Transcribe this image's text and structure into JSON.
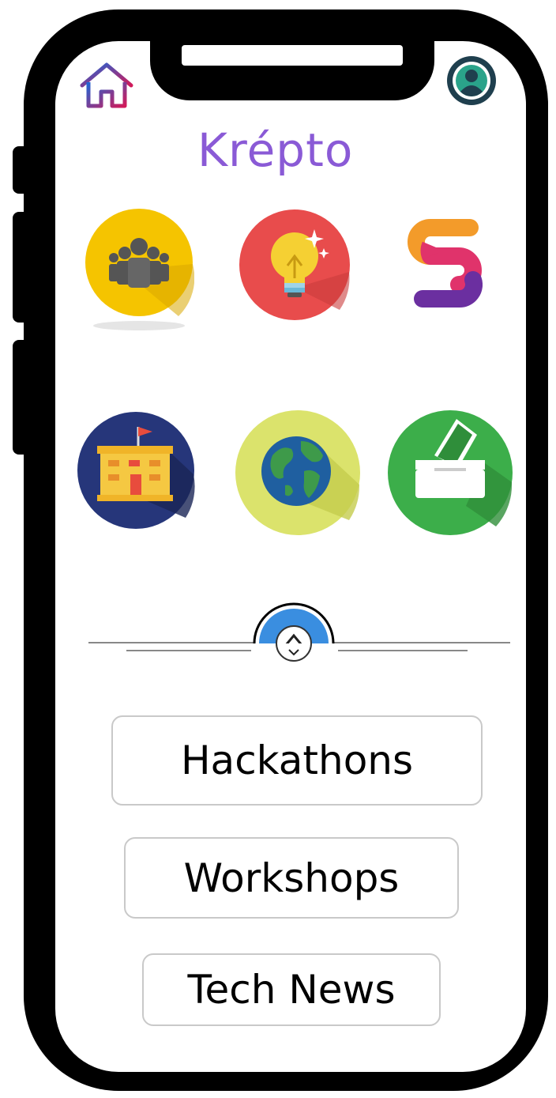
{
  "app": {
    "title": "Krépto"
  },
  "header": {
    "home_icon": "home-icon",
    "profile_icon": "profile-icon"
  },
  "grid_icons": [
    {
      "name": "community-icon",
      "color": "#f5c400"
    },
    {
      "name": "idea-icon",
      "color": "#e84c4c"
    },
    {
      "name": "brand-s-icon",
      "color": "#e0336b"
    },
    {
      "name": "school-icon",
      "color": "#26367a"
    },
    {
      "name": "globe-icon",
      "color": "#dbe36c"
    },
    {
      "name": "vote-icon",
      "color": "#3cae4a"
    }
  ],
  "menu": {
    "hackathons": "Hackathons",
    "workshops": "Workshops",
    "tech_news": "Tech News"
  },
  "colors": {
    "brand": "#8a5ad6",
    "frame": "#000000",
    "button_border": "#c9c9c9"
  }
}
